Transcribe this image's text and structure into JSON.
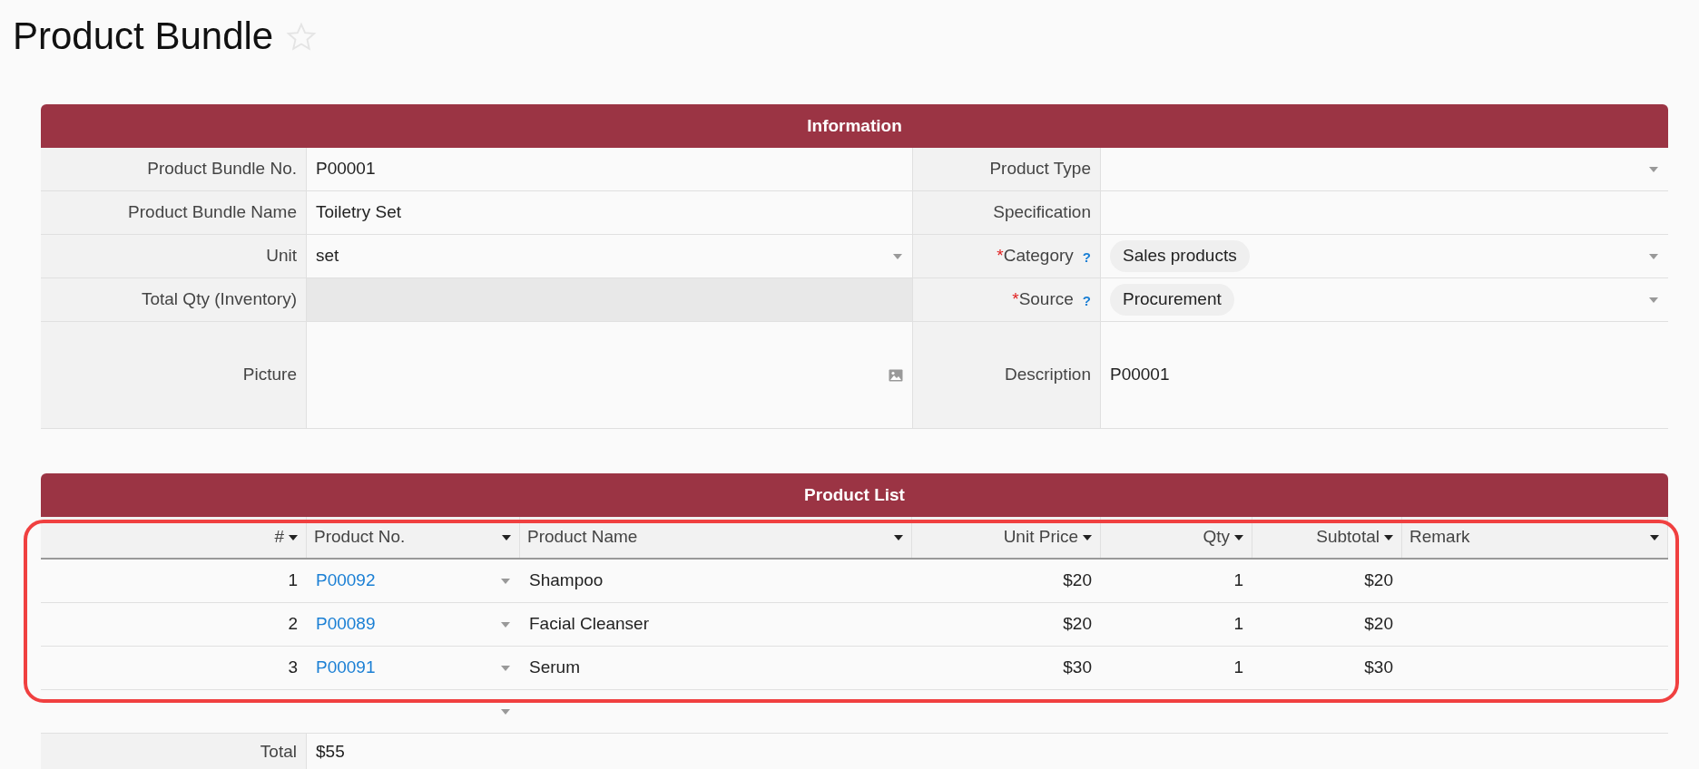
{
  "page": {
    "title": "Product Bundle",
    "favorite": false
  },
  "information": {
    "title": "Information",
    "rows": [
      {
        "left": {
          "label": "Product Bundle No.",
          "kind": "text",
          "value": "P00001"
        },
        "right": {
          "label": "Product Type",
          "kind": "select"
        }
      },
      {
        "left": {
          "label": "Product Bundle Name",
          "kind": "text",
          "value": "Toiletry Set"
        },
        "right": {
          "label": "Specification",
          "kind": "text"
        }
      },
      {
        "left": {
          "label": "Unit",
          "kind": "select",
          "value": "set"
        },
        "right": {
          "label": "Category",
          "marker": "*",
          "help": "?",
          "kind": "chip-select",
          "value": "Sales products"
        }
      },
      {
        "left": {
          "label": "Total Qty (Inventory)",
          "kind": "readonly"
        },
        "right": {
          "label": "Source",
          "marker": "*",
          "help": "?",
          "kind": "chip-select",
          "value": "Procurement"
        }
      },
      {
        "left": {
          "label": "Picture",
          "kind": "picture"
        },
        "right": {
          "label": "Description",
          "kind": "text",
          "value": "P00001"
        }
      }
    ]
  },
  "product_list": {
    "title": "Product List",
    "columns": [
      {
        "label": "#",
        "kind": "number"
      },
      {
        "label": "Product No.",
        "kind": "text"
      },
      {
        "label": "Product Name",
        "kind": "text"
      },
      {
        "label": "Unit Price",
        "kind": "number"
      },
      {
        "label": "Qty",
        "kind": "number"
      },
      {
        "label": "Subtotal",
        "kind": "number"
      },
      {
        "label": "Remark",
        "kind": "text"
      }
    ],
    "rows": [
      {
        "index": "1",
        "product_no": "P00092",
        "product_name": "Shampoo",
        "unit_price": "$20",
        "qty": "1",
        "subtotal": "$20"
      },
      {
        "index": "2",
        "product_no": "P00089",
        "product_name": "Facial Cleanser",
        "unit_price": "$20",
        "qty": "1",
        "subtotal": "$20"
      },
      {
        "index": "3",
        "product_no": "P00091",
        "product_name": "Serum",
        "unit_price": "$30",
        "qty": "1",
        "subtotal": "$30"
      }
    ],
    "highlighted": true
  },
  "total": {
    "label": "Total",
    "value": "$55"
  }
}
